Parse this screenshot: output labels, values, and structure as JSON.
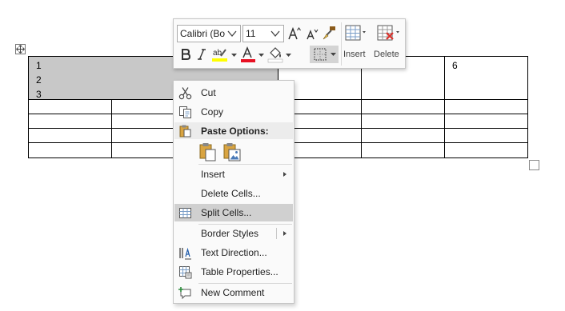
{
  "table": {
    "merged_cell_lines": [
      "1",
      "2",
      "3"
    ],
    "cell_top_right": "6"
  },
  "mini_toolbar": {
    "font_name": "Calibri (Bo",
    "font_size": "11",
    "insert_label": "Insert",
    "delete_label": "Delete",
    "highlight_color": "#ffff00",
    "font_color": "#e81123"
  },
  "context_menu": {
    "cut": "Cut",
    "copy": "Copy",
    "paste_options": "Paste Options:",
    "insert": "Insert",
    "delete_cells": "Delete Cells...",
    "split_cells": "Split Cells...",
    "border_styles": "Border Styles",
    "text_direction": "Text Direction...",
    "table_properties": "Table Properties...",
    "new_comment": "New Comment"
  }
}
